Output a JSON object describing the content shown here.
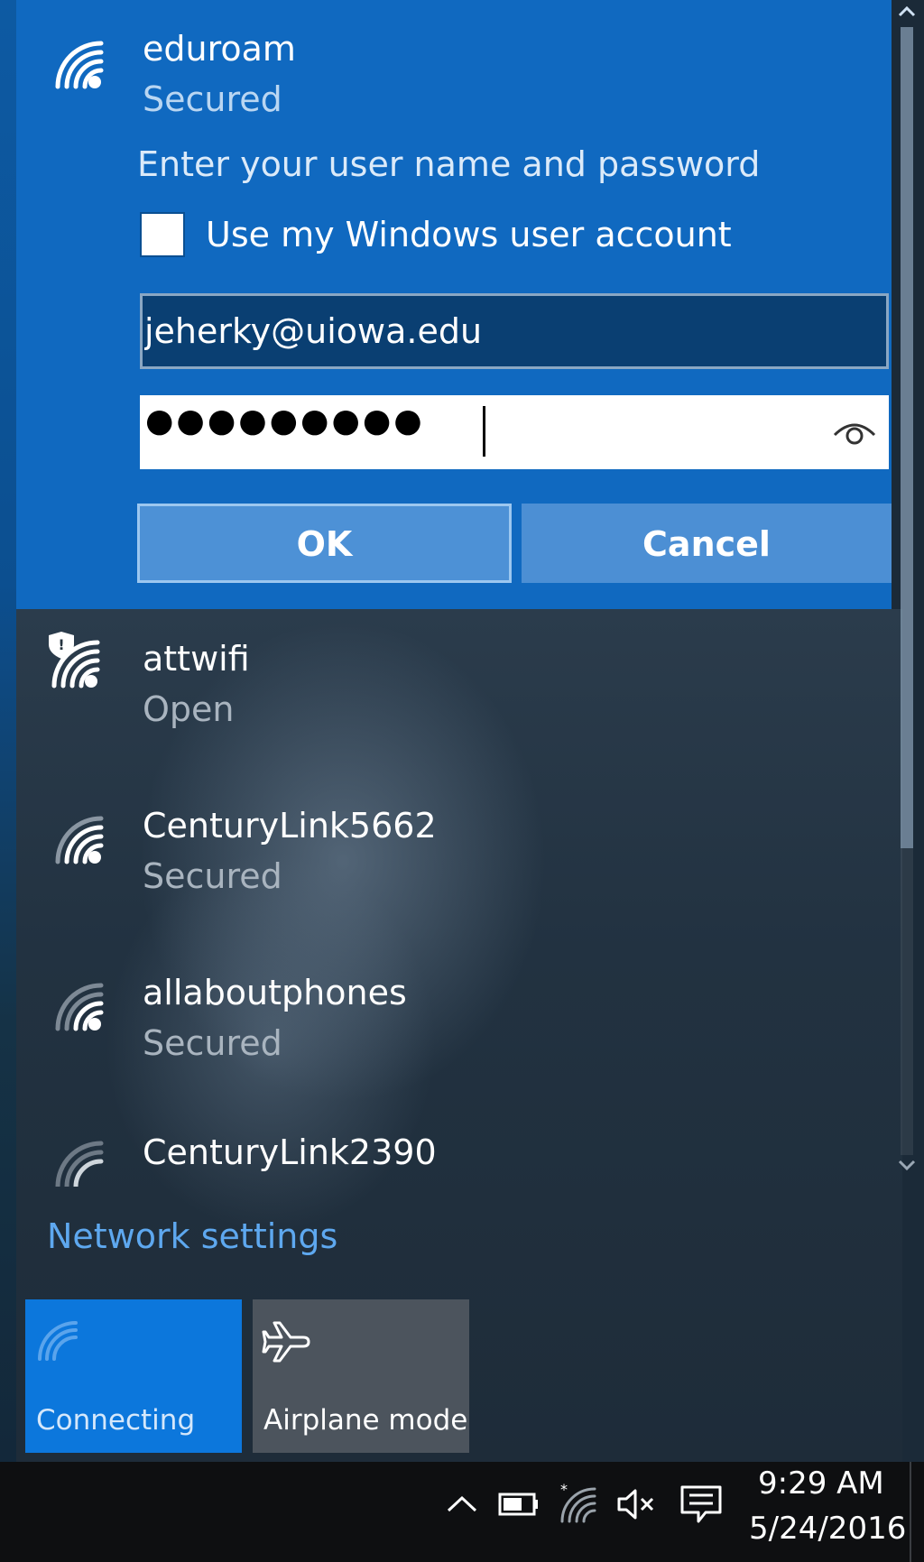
{
  "selected_network": {
    "name": "eduroam",
    "status": "Secured",
    "prompt": "Enter your user name and password",
    "use_windows_account_label": "Use my Windows user account",
    "use_windows_account_checked": false,
    "username_value": "jeherky@uiowa.edu",
    "password_mask": "●●●●●●●●●",
    "ok_label": "OK",
    "cancel_label": "Cancel"
  },
  "networks": [
    {
      "name": "attwifi",
      "status": "Open",
      "icon": "wifi-shield-icon"
    },
    {
      "name": "CenturyLink5662",
      "status": "Secured",
      "icon": "wifi-icon"
    },
    {
      "name": "allaboutphones",
      "status": "Secured",
      "icon": "wifi-icon"
    },
    {
      "name": "CenturyLink2390",
      "status": "",
      "icon": "wifi-icon"
    }
  ],
  "network_settings_label": "Network settings",
  "quick_actions": [
    {
      "label": "Connecting",
      "icon": "wifi-icon",
      "active": true
    },
    {
      "label": "Airplane mode",
      "icon": "airplane-icon",
      "active": false
    }
  ],
  "taskbar": {
    "time": "9:29 AM",
    "date": "5/24/2016",
    "tray_icons": [
      "chevron-up-icon",
      "battery-icon",
      "wifi-icon",
      "volume-muted-icon",
      "action-center-icon"
    ]
  },
  "colors": {
    "accent": "#1069c0",
    "link": "#5ea8ef",
    "tile_active": "#0c77dc",
    "tile_inactive": "#4c545d"
  }
}
